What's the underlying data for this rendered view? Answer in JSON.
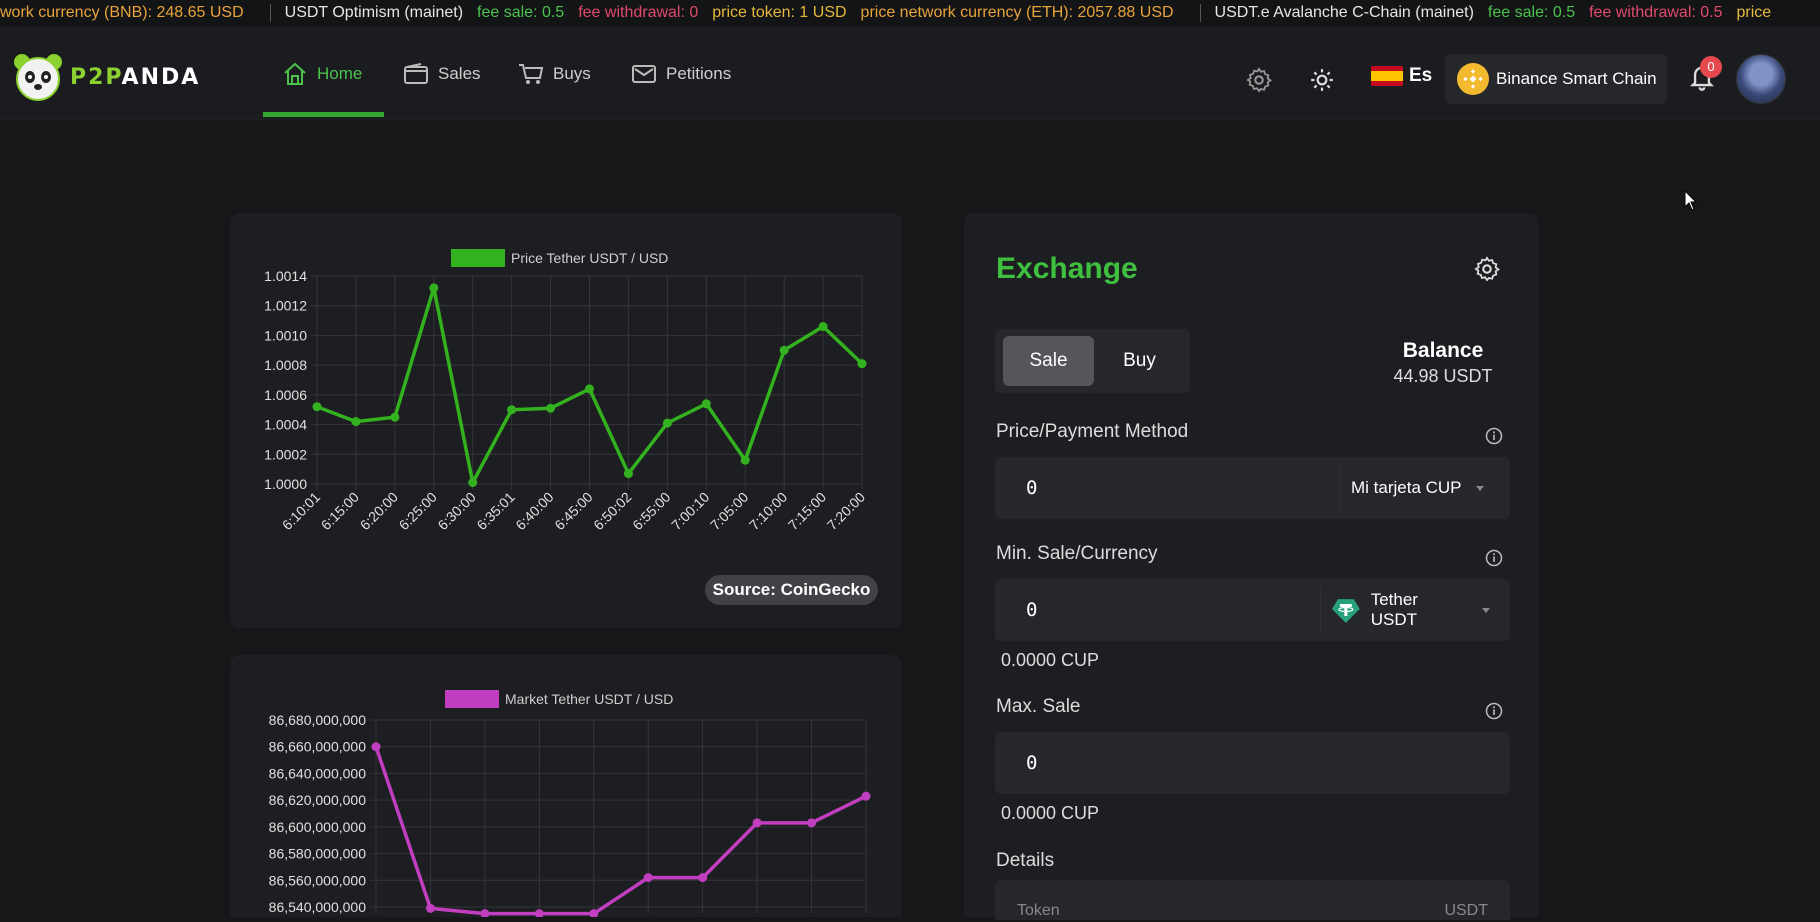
{
  "ticker": [
    {
      "text": "work currency (BNB): 248.65 USD",
      "color": "orange"
    },
    {
      "sep": true
    },
    {
      "text": "USDT Optimism (mainet)",
      "color": "white"
    },
    {
      "text": "fee sale: 0.5",
      "color": "green"
    },
    {
      "text": "fee withdrawal: 0",
      "color": "red"
    },
    {
      "text": "price token: 1 USD",
      "color": "yellow"
    },
    {
      "text": "price network currency (ETH): 2057.88 USD",
      "color": "orange"
    },
    {
      "sep": true
    },
    {
      "text": "USDT.e Avalanche C-Chain (mainet)",
      "color": "white"
    },
    {
      "text": "fee sale: 0.5",
      "color": "green"
    },
    {
      "text": "fee withdrawal: 0.5",
      "color": "red"
    },
    {
      "text": "price",
      "color": "yellow"
    }
  ],
  "header": {
    "logo_text": "P2PANDA",
    "nav": [
      {
        "label": "Home",
        "icon": "home-icon",
        "active": true
      },
      {
        "label": "Sales",
        "icon": "wallet-icon",
        "active": false
      },
      {
        "label": "Buys",
        "icon": "cart-icon",
        "active": false
      },
      {
        "label": "Petitions",
        "icon": "mail-icon",
        "active": false
      }
    ],
    "language": "Es",
    "chain": "Binance Smart Chain",
    "notification_count": "0"
  },
  "price_chart": {
    "source": "Source: CoinGecko"
  },
  "exchange": {
    "title": "Exchange",
    "tab_sale": "Sale",
    "tab_buy": "Buy",
    "balance_label": "Balance",
    "balance_value": "44.98 USDT",
    "price_label": "Price/Payment Method",
    "price_value": "0",
    "payment_method": "Mi tarjeta CUP",
    "min_label": "Min. Sale/Currency",
    "min_value": "0",
    "currency": "Tether USDT",
    "min_converted": "0.0000 CUP",
    "max_label": "Max. Sale",
    "max_value": "0",
    "max_converted": "0.0000 CUP",
    "details_label": "Details",
    "details_token_key": "Token",
    "details_token_value": "USDT"
  },
  "colors": {
    "accent_green": "#3fbf3f",
    "line_green": "#33b11f",
    "line_magenta": "#c23ec0",
    "background": "#161719",
    "card": "#1d1e21"
  },
  "chart_data": [
    {
      "type": "line",
      "legend": "Price Tether USDT / USD",
      "x": [
        "6:10:01",
        "6:15:00",
        "6:20:00",
        "6:25:00",
        "6:30:00",
        "6:35:01",
        "6:40:00",
        "6:45:00",
        "6:50:02",
        "6:55:00",
        "7:00:10",
        "7:05:00",
        "7:10:00",
        "7:15:00",
        "7:20:00"
      ],
      "values": [
        1.00052,
        1.00042,
        1.00045,
        1.00132,
        1.00001,
        1.0005,
        1.00051,
        1.00064,
        1.00007,
        1.00041,
        1.00054,
        1.00016,
        1.0009,
        1.00106,
        1.00081
      ],
      "yticks": [
        "1.0000",
        "1.0002",
        "1.0004",
        "1.0006",
        "1.0008",
        "1.0010",
        "1.0012",
        "1.0014"
      ],
      "ylim": [
        1.0,
        1.0014
      ],
      "grid": true,
      "legend_position": "top"
    },
    {
      "type": "line",
      "legend": "Market Tether USDT / USD",
      "values": [
        86660000000,
        86539000000,
        86535000000,
        86535000000,
        86535000000,
        86562000000,
        86562000000,
        86603000000,
        86603000000,
        86623000000
      ],
      "yticks": [
        "86,540,000,000",
        "86,560,000,000",
        "86,580,000,000",
        "86,600,000,000",
        "86,620,000,000",
        "86,640,000,000",
        "86,660,000,000",
        "86,680,000,000"
      ],
      "ylim": [
        86540000000,
        86680000000
      ],
      "grid": true,
      "legend_position": "top"
    }
  ]
}
